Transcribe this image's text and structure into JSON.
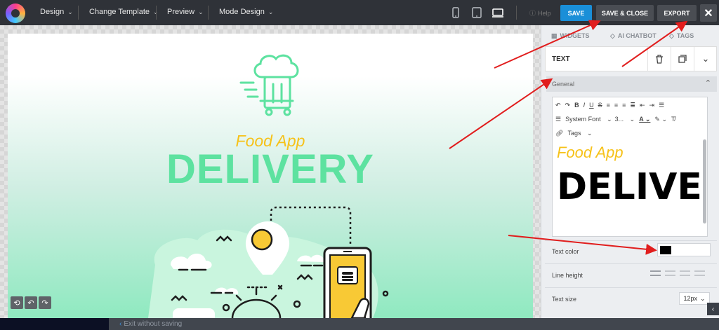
{
  "topbar": {
    "menus": [
      "Design",
      "Change Template",
      "Preview",
      "Mode Design"
    ],
    "help": "Help",
    "save": "SAVE",
    "save_close": "SAVE & CLOSE",
    "export": "EXPORT",
    "close_glyph": "✕"
  },
  "canvas": {
    "subtitle": "Food App",
    "title": "DELIVERY"
  },
  "panel": {
    "tabs": [
      "WIDGETS",
      "AI CHATBOT",
      "TAGS"
    ],
    "section_title": "TEXT",
    "general": "General",
    "toolbar": {
      "font": "System Font",
      "size": "3...",
      "tags": "Tags"
    },
    "editor_line1": "Food App",
    "editor_line2": "DELIVE",
    "text_color_label": "Text color",
    "line_height_label": "Line height",
    "text_size_label": "Text size",
    "text_size_value": "12px",
    "text_color_value": "#000000"
  },
  "bottom": {
    "exit": "Exit without saving"
  },
  "colors": {
    "accent": "#1a8fd8",
    "title_green": "#5de2a0",
    "subtitle_yellow": "#f6c21a",
    "annotation_arrow": "#e11d1d"
  }
}
